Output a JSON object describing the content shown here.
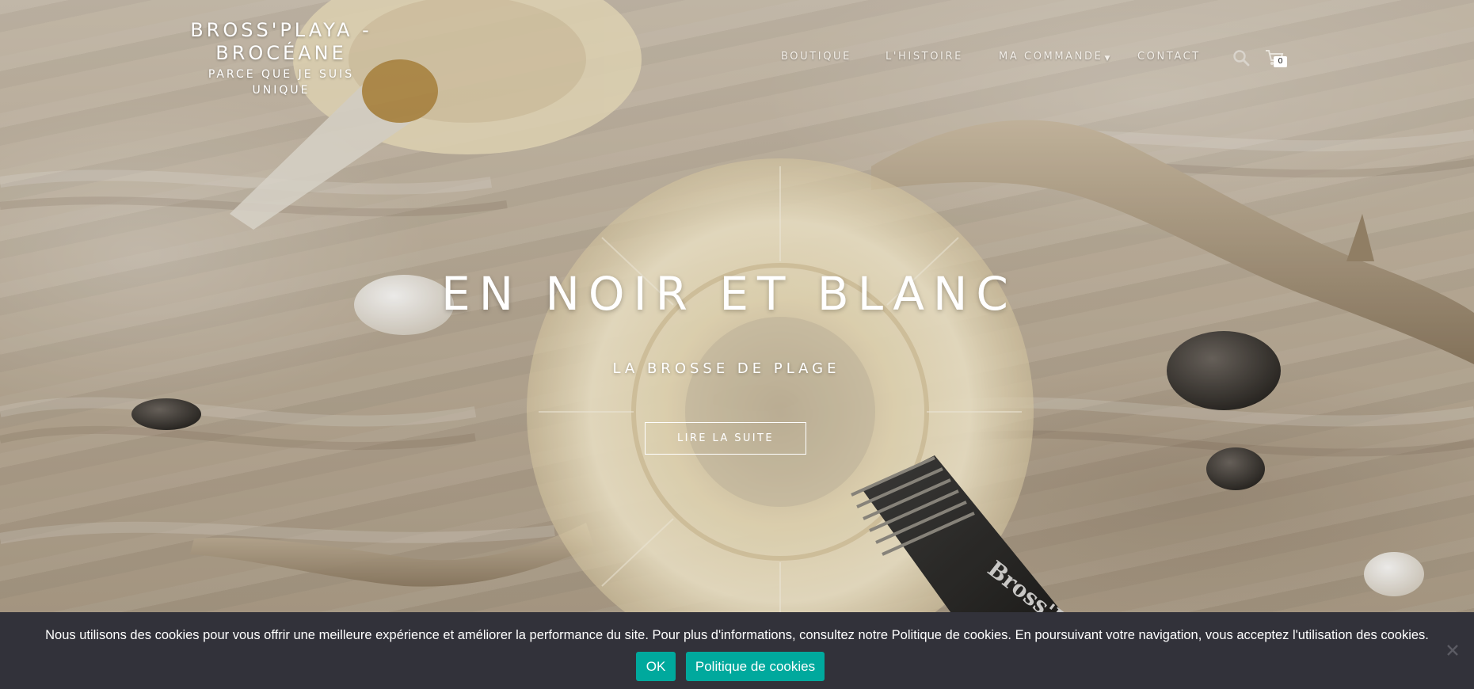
{
  "header": {
    "site_title_line1": "BROSS'PLAYA -",
    "site_title_line2": "BROCÉANE",
    "tagline_line1": "PARCE QUE JE SUIS",
    "tagline_line2": "UNIQUE",
    "nav": [
      {
        "label": "BOUTIQUE"
      },
      {
        "label": "L'HISTOIRE"
      },
      {
        "label": "MA COMMANDE",
        "has_dropdown": true
      },
      {
        "label": "CONTACT"
      }
    ],
    "search_icon": "search-icon",
    "cart_icon": "cart-icon",
    "cart_count": "0"
  },
  "hero": {
    "title": "EN NOIR ET BLANC",
    "subtitle": "LA BROSSE DE PLAGE",
    "button_label": "LIRE LA SUITE",
    "brush_handle_text": "Bross'P"
  },
  "cookie_bar": {
    "text": "Nous utilisons des cookies pour vous offrir une meilleure expérience et améliorer la performance du site. Pour plus d'informations, consultez notre Politique de cookies. En poursuivant votre navigation, vous acceptez l'utilisation des cookies.",
    "ok_label": "OK",
    "policy_label": "Politique de cookies",
    "close_icon": "close-icon"
  },
  "colors": {
    "accent": "#00a99d",
    "cookie_bar_bg": "#32323a",
    "text_light": "#ffffff"
  }
}
